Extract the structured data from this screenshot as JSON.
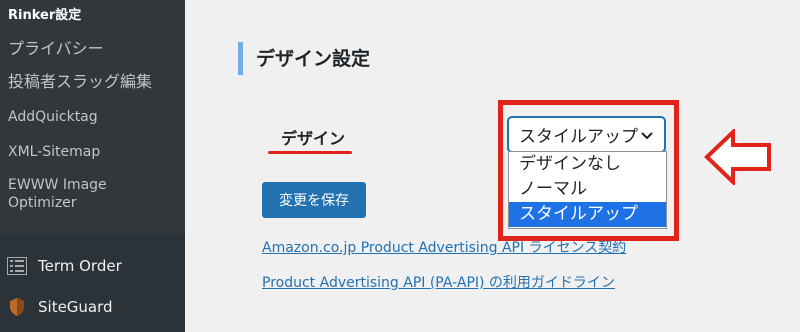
{
  "sidebar": {
    "submenu": [
      {
        "label": "Rinker設定"
      },
      {
        "label": "プライバシー"
      },
      {
        "label": "投稿者スラッグ編集"
      },
      {
        "label": "AddQuicktag"
      },
      {
        "label": "XML-Sitemap"
      },
      {
        "label": "EWWW Image"
      },
      {
        "label": "Optimizer"
      }
    ],
    "menu": [
      {
        "label": "Term Order",
        "icon": "list-icon"
      },
      {
        "label": "SiteGuard",
        "icon": "shield-icon"
      }
    ]
  },
  "main": {
    "heading": "デザイン設定",
    "field_label": "デザイン",
    "select": {
      "value": "スタイルアップ",
      "options": [
        "デザインなし",
        "ノーマル",
        "スタイルアップ"
      ],
      "selected_index": 2
    },
    "save_label": "変更を保存",
    "links": [
      "Amazon.co.jp Product Advertising API ライセンス契約",
      "Product Advertising API (PA-API) の利用ガイドライン"
    ]
  },
  "colors": {
    "sidebar_bg": "#2c3338",
    "accent": "#2271b1",
    "highlight_red": "#e2231a",
    "option_selected": "#1e72e6"
  }
}
